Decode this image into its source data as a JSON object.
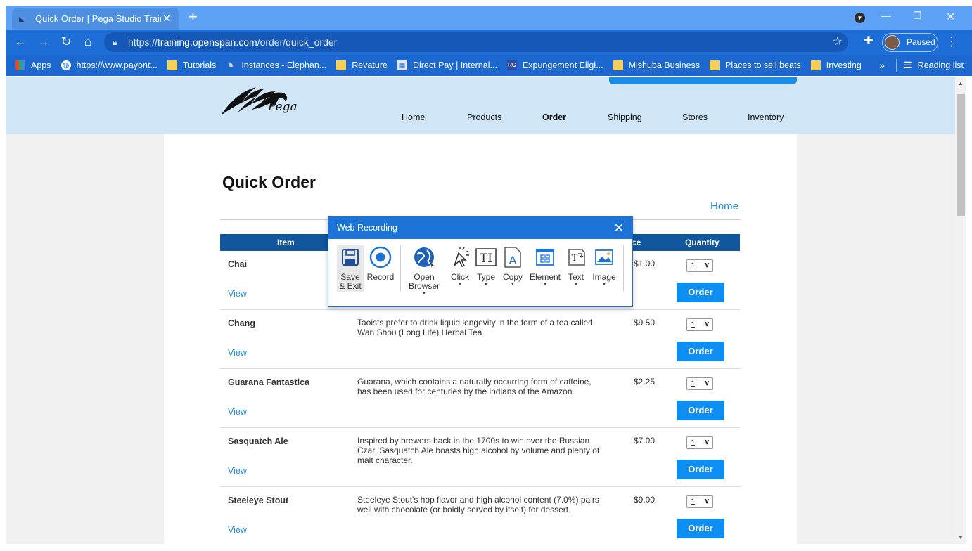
{
  "browser": {
    "tab_title": "Quick Order | Pega Studio Trainin",
    "tab_close": "✕",
    "new_tab": "+",
    "url_prefix": "https://",
    "url_host": "training.openspan.com",
    "url_path": "/order/quick_order",
    "profile_status": "Paused",
    "bookmarks": [
      {
        "label": "Apps",
        "icon": "apps-grid-icon"
      },
      {
        "label": "https://www.payont...",
        "icon": "globe-icon"
      },
      {
        "label": "Tutorials",
        "icon": "folder-icon"
      },
      {
        "label": "Instances - Elephan...",
        "icon": "elephant-icon"
      },
      {
        "label": "Revature",
        "icon": "folder-icon"
      },
      {
        "label": "Direct Pay | Internal...",
        "icon": "direct-pay-icon"
      },
      {
        "label": "Expungement Eligi...",
        "icon": "rc-icon"
      },
      {
        "label": "Mishuba Business",
        "icon": "folder-icon"
      },
      {
        "label": "Places to sell beats",
        "icon": "folder-icon"
      },
      {
        "label": "Investing",
        "icon": "folder-icon"
      }
    ],
    "bookmarks_overflow": "»",
    "reading_list": "Reading list"
  },
  "site": {
    "logo_text": "Pega",
    "nav": [
      "Home",
      "Products",
      "Order",
      "Shipping",
      "Stores",
      "Inventory"
    ],
    "active_nav": "Order"
  },
  "page": {
    "title": "Quick Order",
    "home_link": "Home",
    "columns": [
      "Item",
      "ce",
      "Quantity"
    ],
    "view_label": "View",
    "order_label": "Order",
    "products": [
      {
        "name": "Chai",
        "description": "",
        "price": "$1.00",
        "qty": "1"
      },
      {
        "name": "Chang",
        "description": "Taoists prefer to drink liquid longevity in the form of a tea called Wan Shou (Long Life) Herbal Tea.",
        "price": "$9.50",
        "qty": "1"
      },
      {
        "name": "Guarana Fantastica",
        "description": "Guarana, which contains a naturally occurring form of caffeine, has been used for centuries by the indians of the Amazon.",
        "price": "$2.25",
        "qty": "1"
      },
      {
        "name": "Sasquatch Ale",
        "description": "Inspired by brewers back in the 1700s to win over the Russian Czar, Sasquatch Ale boasts high alcohol by volume and plenty of malt character.",
        "price": "$7.00",
        "qty": "1"
      },
      {
        "name": "Steeleye Stout",
        "description": "Steeleye Stout's hop flavor and high alcohol content (7.0%) pairs well with chocolate (or boldly served by itself) for dessert.",
        "price": "$9.00",
        "qty": "1"
      }
    ]
  },
  "recorder": {
    "title": "Web Recording",
    "close": "✕",
    "tools": [
      {
        "label": "Save & Exit",
        "icon": "save-icon"
      },
      {
        "label": "Record",
        "icon": "record-icon"
      },
      {
        "label": "Open Browser",
        "icon": "open-browser-icon"
      },
      {
        "label": "Click",
        "icon": "click-cursor-icon"
      },
      {
        "label": "Type",
        "icon": "type-text-icon"
      },
      {
        "label": "Copy",
        "icon": "copy-icon"
      },
      {
        "label": "Element",
        "icon": "element-icon"
      },
      {
        "label": "Text",
        "icon": "text-icon"
      },
      {
        "label": "Image",
        "icon": "image-icon"
      }
    ]
  },
  "colors": {
    "tab_strip": "#5ea2f5",
    "toolbar": "#1e6ed8",
    "header_bg": "#d0e5f5",
    "table_head": "#10579e",
    "order_button": "#0d8ef0",
    "link": "#1a8ee8",
    "recorder_head": "#1e74d6"
  }
}
